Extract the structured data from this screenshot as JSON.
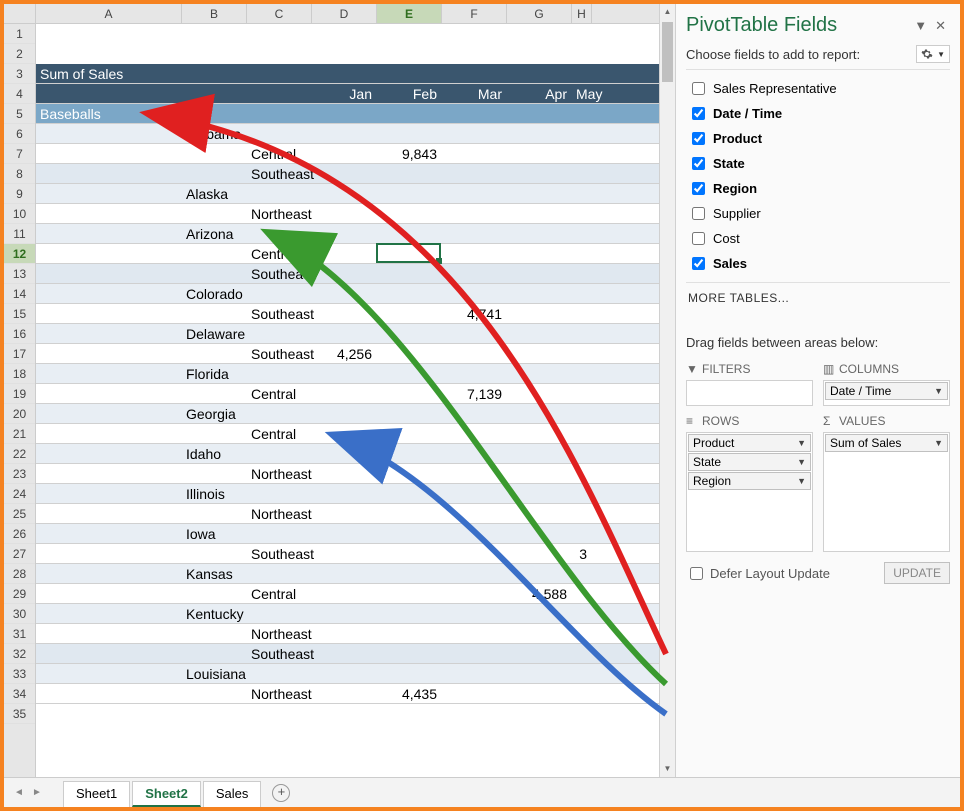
{
  "column_headers": [
    "A",
    "B",
    "C",
    "D",
    "E",
    "F",
    "G",
    "H"
  ],
  "selected_column": "E",
  "row_numbers_start": 1,
  "selected_row": 12,
  "visible_rows": 35,
  "header": {
    "title": "Sum of Sales"
  },
  "months": [
    "Jan",
    "Feb",
    "Mar",
    "Apr",
    "May"
  ],
  "product_row": {
    "label": "Baseballs"
  },
  "rows": [
    {
      "r": 1,
      "type": "blank"
    },
    {
      "r": 2,
      "type": "blank"
    },
    {
      "r": 3,
      "type": "title"
    },
    {
      "r": 4,
      "type": "months"
    },
    {
      "r": 5,
      "type": "product"
    },
    {
      "r": 6,
      "type": "state",
      "state": "Alabama"
    },
    {
      "r": 7,
      "type": "region",
      "region": "Central",
      "band": "A",
      "vals": {
        "E": "9,843"
      }
    },
    {
      "r": 8,
      "type": "region",
      "region": "Southeast",
      "band": "B"
    },
    {
      "r": 9,
      "type": "state",
      "state": "Alaska"
    },
    {
      "r": 10,
      "type": "region",
      "region": "Northeast",
      "band": "A"
    },
    {
      "r": 11,
      "type": "state",
      "state": "Arizona"
    },
    {
      "r": 12,
      "type": "region",
      "region": "Central",
      "band": "A"
    },
    {
      "r": 13,
      "type": "region",
      "region": "Southeast",
      "band": "B"
    },
    {
      "r": 14,
      "type": "state",
      "state": "Colorado"
    },
    {
      "r": 15,
      "type": "region",
      "region": "Southeast",
      "band": "A",
      "vals": {
        "F": "4,741"
      }
    },
    {
      "r": 16,
      "type": "state",
      "state": "Delaware"
    },
    {
      "r": 17,
      "type": "region",
      "region": "Southeast",
      "band": "A",
      "vals": {
        "D": "4,256"
      }
    },
    {
      "r": 18,
      "type": "state",
      "state": "Florida"
    },
    {
      "r": 19,
      "type": "region",
      "region": "Central",
      "band": "A",
      "vals": {
        "F": "7,139"
      }
    },
    {
      "r": 20,
      "type": "state",
      "state": "Georgia"
    },
    {
      "r": 21,
      "type": "region",
      "region": "Central",
      "band": "A"
    },
    {
      "r": 22,
      "type": "state",
      "state": "Idaho"
    },
    {
      "r": 23,
      "type": "region",
      "region": "Northeast",
      "band": "A"
    },
    {
      "r": 24,
      "type": "state",
      "state": "Illinois"
    },
    {
      "r": 25,
      "type": "region",
      "region": "Northeast",
      "band": "A"
    },
    {
      "r": 26,
      "type": "state",
      "state": "Iowa"
    },
    {
      "r": 27,
      "type": "region",
      "region": "Southeast",
      "band": "A",
      "vals": {
        "H": "3"
      }
    },
    {
      "r": 28,
      "type": "state",
      "state": "Kansas"
    },
    {
      "r": 29,
      "type": "region",
      "region": "Central",
      "band": "A",
      "vals": {
        "G": "4,588"
      }
    },
    {
      "r": 30,
      "type": "state",
      "state": "Kentucky"
    },
    {
      "r": 31,
      "type": "region",
      "region": "Northeast",
      "band": "A"
    },
    {
      "r": 32,
      "type": "region",
      "region": "Southeast",
      "band": "B"
    },
    {
      "r": 33,
      "type": "state",
      "state": "Louisiana"
    },
    {
      "r": 34,
      "type": "region",
      "region": "Northeast",
      "band": "A",
      "vals": {
        "E": "4,435"
      }
    },
    {
      "r": 35,
      "type": "blank"
    }
  ],
  "pane": {
    "title": "PivotTable Fields",
    "subtitle": "Choose fields to add to report:",
    "fields": [
      {
        "label": "Sales Representative",
        "checked": false,
        "bold": false
      },
      {
        "label": "Date / Time",
        "checked": true,
        "bold": true
      },
      {
        "label": "Product",
        "checked": true,
        "bold": true
      },
      {
        "label": "State",
        "checked": true,
        "bold": true
      },
      {
        "label": "Region",
        "checked": true,
        "bold": true
      },
      {
        "label": "Supplier",
        "checked": false,
        "bold": false
      },
      {
        "label": "Cost",
        "checked": false,
        "bold": false
      },
      {
        "label": "Sales",
        "checked": true,
        "bold": true
      }
    ],
    "more_tables": "MORE TABLES...",
    "drag_label": "Drag fields between areas below:",
    "areas": {
      "filters": {
        "title": "FILTERS",
        "items": []
      },
      "columns": {
        "title": "COLUMNS",
        "items": [
          "Date / Time"
        ]
      },
      "rows": {
        "title": "ROWS",
        "items": [
          "Product",
          "State",
          "Region"
        ]
      },
      "values": {
        "title": "VALUES",
        "items": [
          "Sum of Sales"
        ]
      }
    },
    "defer": "Defer Layout Update",
    "update": "UPDATE"
  },
  "tabs": {
    "items": [
      "Sheet1",
      "Sheet2",
      "Sales"
    ],
    "active": "Sheet2"
  }
}
